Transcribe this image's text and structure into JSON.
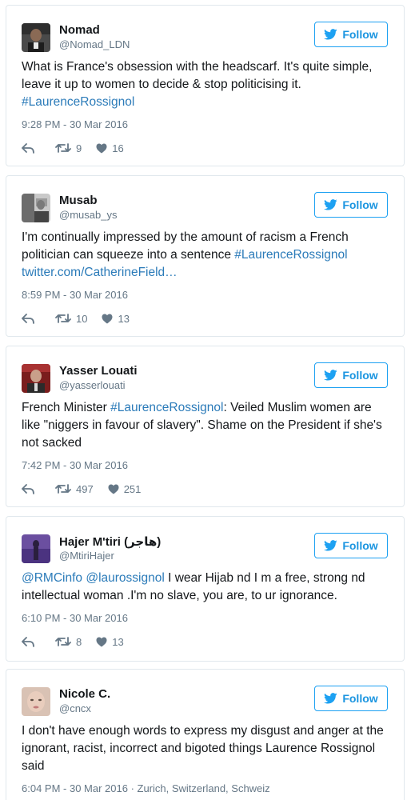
{
  "colors": {
    "link": "#2b7bb9",
    "follow_border": "#1da1f2",
    "muted": "#657786"
  },
  "icons": {
    "follow": "bird-icon",
    "reply": "reply-icon",
    "retweet": "retweet-icon",
    "like": "heart-icon"
  },
  "tweets": [
    {
      "name": "Nomad",
      "handle": "@Nomad_LDN",
      "follow_label": "Follow",
      "text_plain": "What is France's obsession with the headscarf. It's quite simple, leave it up to women to decide & stop politicising it. ",
      "hashtag": "#LaurenceRossignol",
      "time": "9:28 PM - 30 Mar 2016",
      "retweets": "9",
      "likes": "16"
    },
    {
      "name": "Musab",
      "handle": "@musab_ys",
      "follow_label": "Follow",
      "text_plain": "I'm continually impressed by the amount of racism a French politician can squeeze into a sentence ",
      "hashtag": "#LaurenceRossignol",
      "link": "twitter.com/CatherineField…",
      "time": "8:59 PM - 30 Mar 2016",
      "retweets": "10",
      "likes": "13"
    },
    {
      "name": "Yasser Louati",
      "handle": "@yasserlouati",
      "follow_label": "Follow",
      "text_pre": "French Minister ",
      "hashtag": "#LaurenceRossignol",
      "text_post": ": Veiled Muslim women are like \"niggers in favour of slavery\". Shame on the President if she's not sacked",
      "time": "7:42 PM - 30 Mar 2016",
      "retweets": "497",
      "likes": "251"
    },
    {
      "name": "Hajer M'tiri (هاجر)",
      "handle": "@MtiriHajer",
      "follow_label": "Follow",
      "mention1": "@RMCinfo",
      "mention2": "@laurossignol",
      "text_post": " I wear Hijab nd I m a free, strong nd intellectual woman .I'm no slave, you are, to ur ignorance.",
      "time": "6:10 PM - 30 Mar 2016",
      "retweets": "8",
      "likes": "13"
    },
    {
      "name": "Nicole C.",
      "handle": "@cncx",
      "follow_label": "Follow",
      "text_plain": "I don't have enough words to express my disgust and anger at the ignorant, racist, incorrect and bigoted things Laurence Rossignol said",
      "time": "6:04 PM - 30 Mar 2016 · Zurich, Switzerland, Schweiz"
    }
  ]
}
